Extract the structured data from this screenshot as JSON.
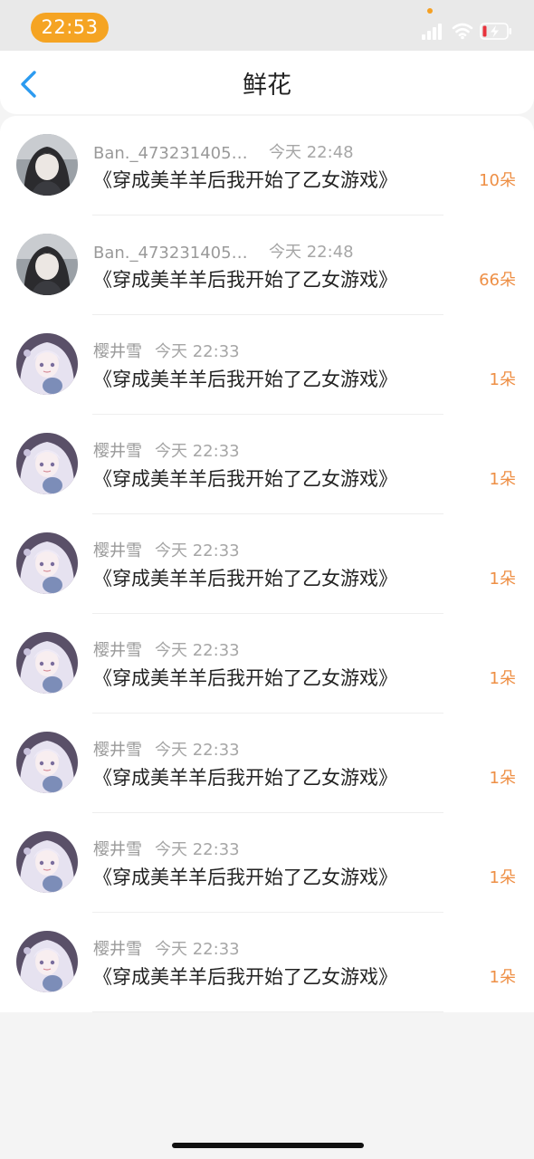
{
  "status_bar": {
    "time": "22:53",
    "colors": {
      "time_pill": "#f5a423",
      "battery_low": "#e8323c"
    }
  },
  "header": {
    "title": "鲜花",
    "back_icon": "chevron-left-icon",
    "accent_color": "#2c9bf0"
  },
  "gifts": [
    {
      "author": "Ban._4732314054...",
      "time": "今天 22:48",
      "book": "《穿成美羊羊后我开始了乙女游戏》",
      "count": "10朵",
      "avatar": "dark"
    },
    {
      "author": "Ban._4732314054...",
      "time": "今天 22:48",
      "book": "《穿成美羊羊后我开始了乙女游戏》",
      "count": "66朵",
      "avatar": "dark"
    },
    {
      "author": "樱井雪",
      "time": "今天 22:33",
      "book": "《穿成美羊羊后我开始了乙女游戏》",
      "count": "1朵",
      "avatar": "anime"
    },
    {
      "author": "樱井雪",
      "time": "今天 22:33",
      "book": "《穿成美羊羊后我开始了乙女游戏》",
      "count": "1朵",
      "avatar": "anime"
    },
    {
      "author": "樱井雪",
      "time": "今天 22:33",
      "book": "《穿成美羊羊后我开始了乙女游戏》",
      "count": "1朵",
      "avatar": "anime"
    },
    {
      "author": "樱井雪",
      "time": "今天 22:33",
      "book": "《穿成美羊羊后我开始了乙女游戏》",
      "count": "1朵",
      "avatar": "anime"
    },
    {
      "author": "樱井雪",
      "time": "今天 22:33",
      "book": "《穿成美羊羊后我开始了乙女游戏》",
      "count": "1朵",
      "avatar": "anime"
    },
    {
      "author": "樱井雪",
      "time": "今天 22:33",
      "book": "《穿成美羊羊后我开始了乙女游戏》",
      "count": "1朵",
      "avatar": "anime"
    },
    {
      "author": "樱井雪",
      "time": "今天 22:33",
      "book": "《穿成美羊羊后我开始了乙女游戏》",
      "count": "1朵",
      "avatar": "anime"
    }
  ],
  "colors": {
    "count": "#ee8f45",
    "meta": "#9a9a9a",
    "text": "#222222",
    "page_background": "#f4f4f4"
  }
}
